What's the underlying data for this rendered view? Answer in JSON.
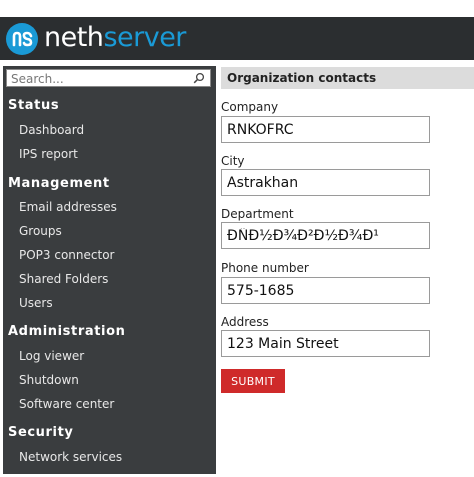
{
  "brand": {
    "part1": "neth",
    "part2": "server"
  },
  "colors": {
    "accent": "#1a9ad6",
    "topbar": "#2b2e30",
    "sidebar": "#3a3d3f",
    "submit": "#cf2a2a"
  },
  "search": {
    "placeholder": "Search..."
  },
  "sidebar": {
    "sections": [
      {
        "title": "Status",
        "items": [
          "Dashboard",
          "IPS report"
        ]
      },
      {
        "title": "Management",
        "items": [
          "Email addresses",
          "Groups",
          "POP3 connector",
          "Shared Folders",
          "Users"
        ]
      },
      {
        "title": "Administration",
        "items": [
          "Log viewer",
          "Shutdown",
          "Software center"
        ]
      },
      {
        "title": "Security",
        "items": [
          "Network services"
        ]
      }
    ]
  },
  "main": {
    "title": "Organization contacts",
    "fields": [
      {
        "label": "Company",
        "value": "RNKOFRC"
      },
      {
        "label": "City",
        "value": "Astrakhan"
      },
      {
        "label": "Department",
        "value": "ÐÑÐ½Ð¾Ð²Ð½Ð¾Ð¹"
      },
      {
        "label": "Phone number",
        "value": "575-1685"
      },
      {
        "label": "Address",
        "value": "123 Main Street"
      }
    ],
    "submit_label": "SUBMIT"
  }
}
